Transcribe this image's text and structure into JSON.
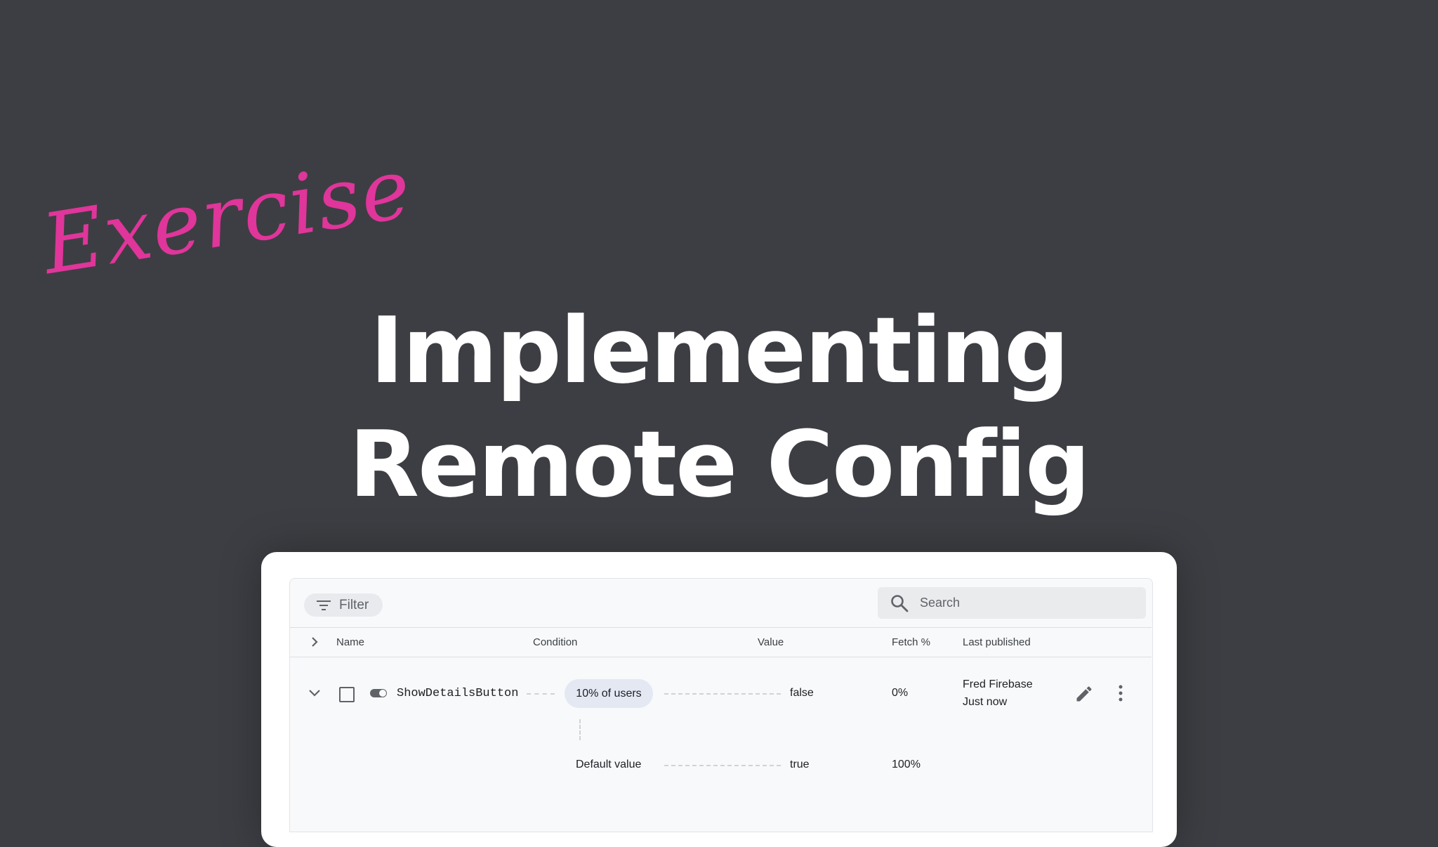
{
  "overlay": {
    "exercise_label": "Exercise"
  },
  "title": {
    "line1": "Implementing",
    "line2": "Remote Config"
  },
  "toolbar": {
    "filter_label": "Filter",
    "search_placeholder": "Search"
  },
  "table": {
    "headers": {
      "name": "Name",
      "condition": "Condition",
      "value": "Value",
      "fetch": "Fetch %",
      "last_published": "Last published"
    },
    "row": {
      "name": "ShowDetailsButton",
      "condition": "10% of users",
      "value": "false",
      "fetch": "0%",
      "publisher": "Fred Firebase",
      "published_time": "Just now"
    },
    "default_row": {
      "label": "Default value",
      "value": "true",
      "fetch": "100%"
    }
  },
  "colors": {
    "background": "#3d3e43",
    "accent": "#e0359a",
    "chip": "#e3e8f3"
  },
  "icons": [
    "filter-icon",
    "search-icon",
    "chevron-right-icon",
    "chevron-down-icon",
    "checkbox-icon",
    "toggle-icon",
    "edit-pencil-icon",
    "more-vert-icon"
  ]
}
